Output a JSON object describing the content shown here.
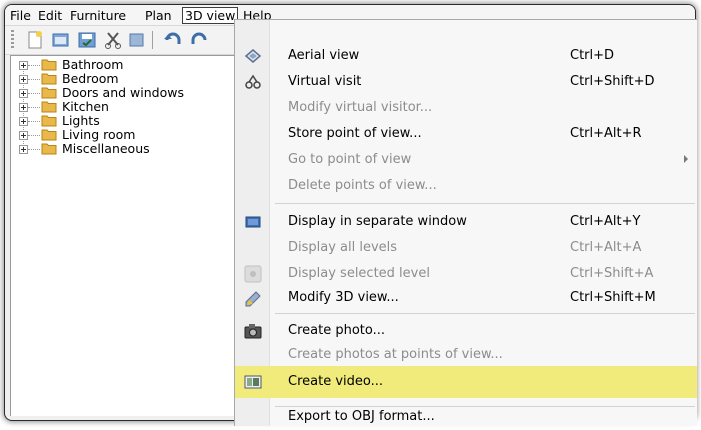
{
  "menubar": {
    "items": [
      "File",
      "Edit",
      "Furniture",
      "Plan",
      "3D view",
      "Help"
    ]
  },
  "toolbar": {
    "icons": [
      "new-icon",
      "open-icon",
      "save-icon",
      "cut-icon",
      "undo-icon"
    ]
  },
  "catalog": {
    "items": [
      "Bathroom",
      "Bedroom",
      "Doors and windows",
      "Kitchen",
      "Lights",
      "Living room",
      "Miscellaneous"
    ]
  },
  "menu3d": {
    "aerial": {
      "label": "Aerial view",
      "shortcut": "Ctrl+D"
    },
    "virtual": {
      "label": "Virtual visit",
      "shortcut": "Ctrl+Shift+D"
    },
    "modify_visitor": {
      "label": "Modify virtual visitor..."
    },
    "store_pov": {
      "label": "Store point of view...",
      "shortcut": "Ctrl+Alt+R"
    },
    "goto_pov": {
      "label": "Go to point of view"
    },
    "delete_pov": {
      "label": "Delete points of view..."
    },
    "separate_window": {
      "label": "Display in separate window",
      "shortcut": "Ctrl+Alt+Y"
    },
    "all_levels": {
      "label": "Display all levels",
      "shortcut": "Ctrl+Alt+A"
    },
    "selected_level": {
      "label": "Display selected level",
      "shortcut": "Ctrl+Shift+A"
    },
    "modify_3d": {
      "label": "Modify 3D view...",
      "shortcut": "Ctrl+Shift+M"
    },
    "create_photo": {
      "label": "Create photo..."
    },
    "create_photos_pov": {
      "label": "Create photos at points of view..."
    },
    "create_video": {
      "label": "Create video..."
    },
    "export_obj": {
      "label": "Export to OBJ format..."
    }
  },
  "colors": {
    "highlight": "#f0eb7a",
    "disabled_text": "#8c8c8c"
  }
}
